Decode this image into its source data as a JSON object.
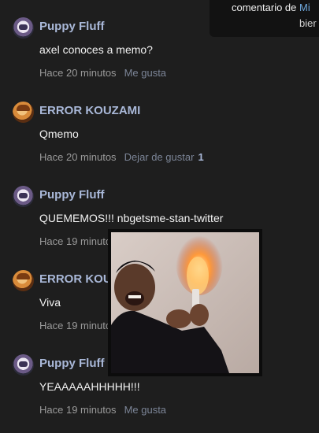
{
  "toast": {
    "line1_prefix": "comentario de ",
    "line1_highlight": "Mi",
    "line2": "bier"
  },
  "comments": [
    {
      "author": "Puppy Fluff",
      "avatar": "puppy-avatar",
      "text": "axel conoces a memo?",
      "time": "Hace 20 minutos",
      "like": "Me gusta",
      "likes": ""
    },
    {
      "author": "ERROR KOUZAMI",
      "avatar": "error-avatar",
      "text": "Qmemo",
      "time": "Hace 20 minutos",
      "like": "Dejar de gustar",
      "likes": "1"
    },
    {
      "author": "Puppy Fluff",
      "avatar": "puppy-avatar",
      "text": "QUEMEMOS!!! nbgetsme-stan-twitter",
      "time": "Hace 19 minutos",
      "like": "",
      "likes": ""
    },
    {
      "author": "ERROR KOUZAMI",
      "avatar": "error-avatar",
      "text": "Viva",
      "time": "Hace 19 minutos",
      "like": "",
      "likes": ""
    },
    {
      "author": "Puppy Fluff",
      "avatar": "puppy-avatar",
      "text": "YEAAAAAHHHHH!!!",
      "time": "Hace 19 minutos",
      "like": "Me gusta",
      "likes": ""
    }
  ],
  "colors": {
    "background": "#1e1e1e",
    "author": "#a9b8d8",
    "meta": "#9a9a9a",
    "like_action": "#7b8496"
  }
}
